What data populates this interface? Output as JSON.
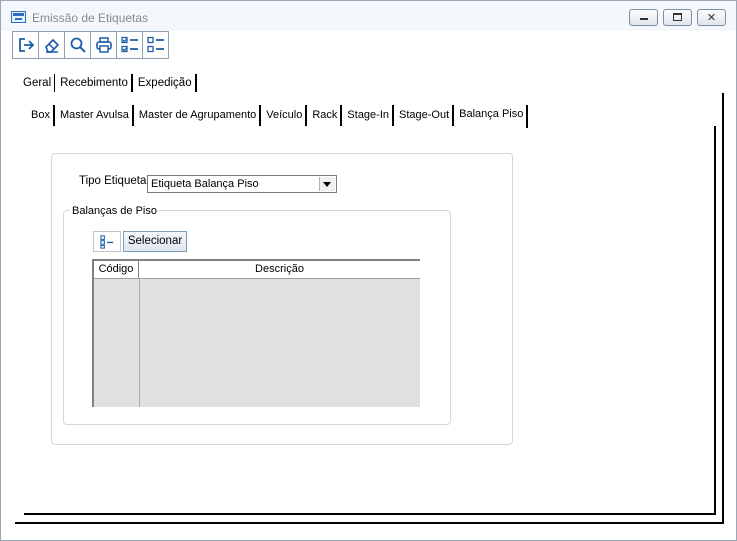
{
  "window": {
    "title": "Emissão de Etiquetas"
  },
  "toolbar": {
    "buttons": [
      {
        "icon": "exit-icon"
      },
      {
        "icon": "eraser-icon"
      },
      {
        "icon": "search-icon"
      },
      {
        "icon": "print-icon"
      },
      {
        "icon": "check-list-icon"
      },
      {
        "icon": "uncheck-list-icon"
      }
    ]
  },
  "main_tabs": [
    {
      "label": "Geral",
      "active": true
    },
    {
      "label": "Recebimento",
      "active": false
    },
    {
      "label": "Expedição",
      "active": false
    }
  ],
  "sub_tabs": [
    {
      "label": "Box",
      "active": false
    },
    {
      "label": "Master Avulsa",
      "active": false
    },
    {
      "label": "Master de Agrupamento",
      "active": false
    },
    {
      "label": "Veículo",
      "active": false
    },
    {
      "label": "Rack",
      "active": false
    },
    {
      "label": "Stage-In",
      "active": false
    },
    {
      "label": "Stage-Out",
      "active": false
    },
    {
      "label": "Balança Piso",
      "active": true
    }
  ],
  "form": {
    "tipo_label": "Tipo Etiqueta",
    "tipo_value": "Etiqueta Balança Piso",
    "group_label": "Balanças de Piso",
    "select_button": "Selecionar",
    "columns": [
      "Código",
      "Descrição"
    ],
    "rows": []
  }
}
